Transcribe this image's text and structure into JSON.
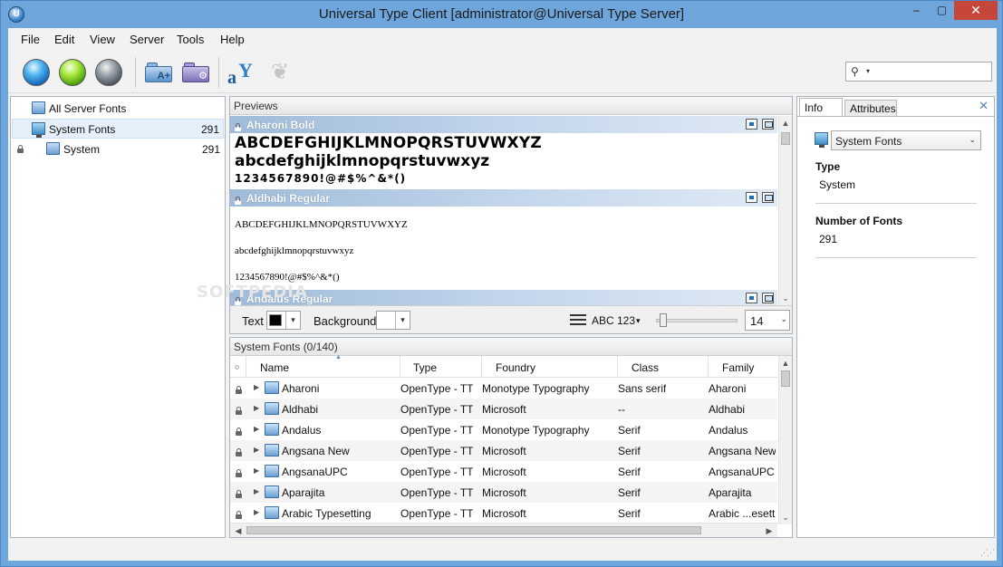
{
  "window": {
    "title": "Universal Type Client [administrator@Universal Type Server]",
    "app_icon_glyph": "U",
    "minimize": "–",
    "maximize": "▢",
    "close": "✕"
  },
  "menu": [
    "File",
    "Edit",
    "View",
    "Server",
    "Tools",
    "Help"
  ],
  "toolbar": {
    "icons": [
      "blue-orb-icon",
      "green-orb-icon",
      "gray-orb-icon",
      "add-font-folder-icon",
      "add-workgroup-folder-icon",
      "font-match-icon",
      "moth-icon"
    ],
    "add_font_glyph": "A+",
    "add_workgroup_glyph": "⚙",
    "font_match_a": "a",
    "font_match_y": "Y",
    "moth_glyph": "❦",
    "search": {
      "glyph": "⚲",
      "dropdown": "▾",
      "value": "",
      "placeholder": ""
    }
  },
  "tree": {
    "items": [
      {
        "label": "All Server Fonts",
        "count": ""
      },
      {
        "label": "System Fonts",
        "count": "291"
      },
      {
        "label": "System",
        "count": "291"
      }
    ]
  },
  "previews": {
    "title": "Previews",
    "fonts": [
      {
        "name": "Aharoni Bold",
        "lines": [
          "ABCDEFGHIJKLMNOPQRSTUVWXYZ",
          "abcdefghijklmnopqrstuvwxyz",
          "1234567890!@#$%^&*()"
        ]
      },
      {
        "name": "Aldhabi Regular",
        "lines": [
          "ABCDEFGHIJKLMNOPQRSTUVWXYZ",
          "abcdefghijklmnopqrstuvwxyz",
          "1234567890!@#$%^&*()"
        ]
      },
      {
        "name": "Andalus Regular",
        "lines": []
      }
    ],
    "watermark": "SOFTPEDIA",
    "scroll_up": "▲",
    "scroll_down": "⌄",
    "controls": {
      "text_label": "Text",
      "text_color": "#000000",
      "background_label": "Background",
      "background_color": "#ffffff",
      "dropdown": "▾",
      "sample_text": "ABC 123",
      "sample_dropdown": "▾",
      "size": "14",
      "size_dropdown": "⌄"
    }
  },
  "font_list": {
    "title": "System Fonts (0/140)",
    "sort_marker": "▲",
    "active_marker": "○",
    "columns": [
      "Name",
      "Type",
      "Foundry",
      "Class",
      "Family"
    ],
    "expander": "▶",
    "rows": [
      {
        "name": "Aharoni",
        "type": "OpenType - TT",
        "foundry": "Monotype Typography",
        "class": "Sans serif",
        "family": "Aharoni"
      },
      {
        "name": "Aldhabi",
        "type": "OpenType - TT",
        "foundry": "Microsoft",
        "class": "--",
        "family": "Aldhabi"
      },
      {
        "name": "Andalus",
        "type": "OpenType - TT",
        "foundry": "Monotype Typography",
        "class": "Serif",
        "family": "Andalus"
      },
      {
        "name": "Angsana New",
        "type": "OpenType - TT",
        "foundry": "Microsoft",
        "class": "Serif",
        "family": "Angsana New"
      },
      {
        "name": "AngsanaUPC",
        "type": "OpenType - TT",
        "foundry": "Microsoft",
        "class": "Serif",
        "family": "AngsanaUPC"
      },
      {
        "name": "Aparajita",
        "type": "OpenType - TT",
        "foundry": "Microsoft",
        "class": "Serif",
        "family": "Aparajita"
      },
      {
        "name": "Arabic Typesetting",
        "type": "OpenType - TT",
        "foundry": "Microsoft",
        "class": "Serif",
        "family": "Arabic ...esettin"
      }
    ],
    "scroll_left": "◀",
    "scroll_right": "▶",
    "scroll_up": "▲",
    "scroll_down": "⌄"
  },
  "info": {
    "tabs": [
      "Info",
      "Attributes"
    ],
    "close": "✕",
    "selected": "System Fonts",
    "dropdown": "⌄",
    "fields": [
      {
        "label": "Type",
        "value": "System"
      },
      {
        "label": "Number of Fonts",
        "value": "291"
      }
    ]
  },
  "status": {
    "grip": "⋰⋰"
  }
}
